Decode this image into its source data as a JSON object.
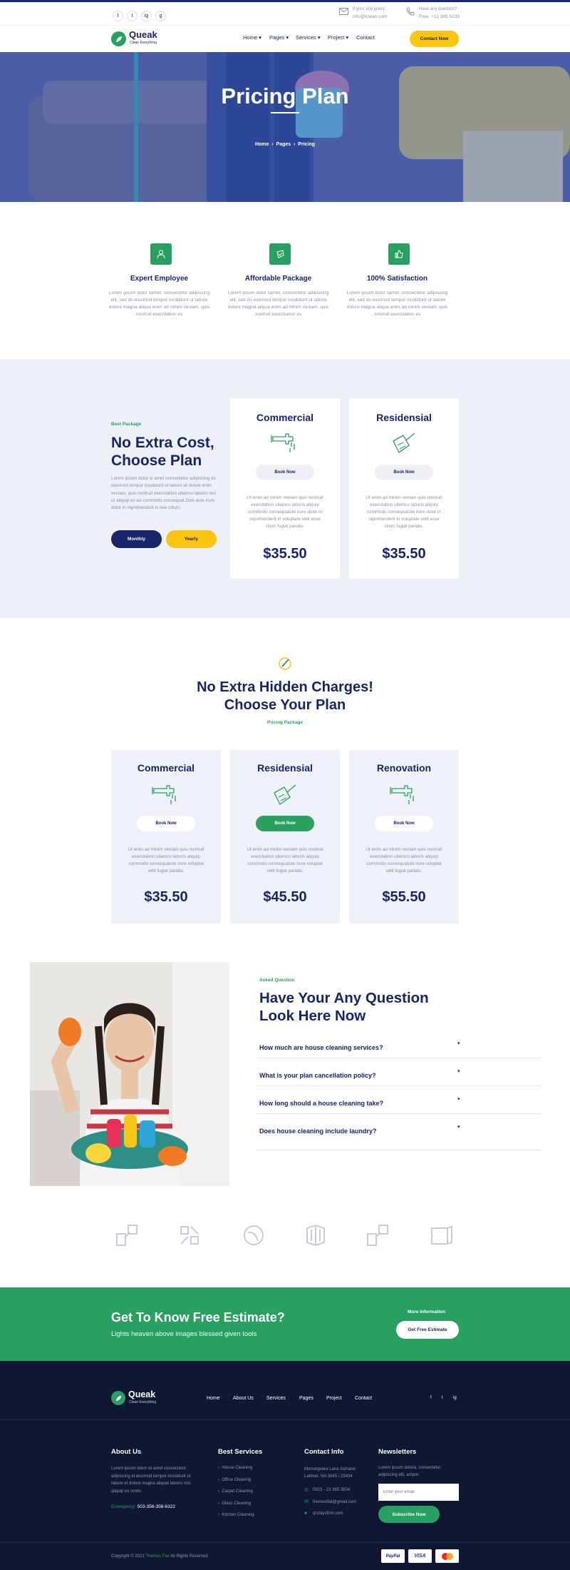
{
  "topbar": {
    "social": [
      "f",
      "t",
      "ig",
      "g"
    ],
    "query_label": "If your any query",
    "query_value": "info@tclean.com",
    "question_label": "Have any question?",
    "question_value": "Free. +12 365 5233"
  },
  "nav": {
    "brand": "Queak",
    "tagline": "Clean Everything",
    "items": [
      {
        "label": "Home"
      },
      {
        "label": "Pages"
      },
      {
        "label": "Services"
      },
      {
        "label": "Project"
      },
      {
        "label": "Contact"
      }
    ],
    "cta": "Contact Now"
  },
  "hero": {
    "title": "Pricing Plan",
    "crumbs": [
      "Home",
      "Pages",
      "Pricing"
    ]
  },
  "features": [
    {
      "icon": "employee-icon",
      "title": "Expert Employee",
      "desc": "Lorem ipsum dolor samet, consectetur adipiscing elit, sed do eiusmod tempor incididunt ut labore dolore magna aliqua enim ad minim veniam, quis nostrud exercitation es"
    },
    {
      "icon": "package-icon",
      "title": "Affordable Package",
      "desc": "Lorem ipsum dolor samet, consectetur adipiscing elit, sed do eiusmod tempor incididunt ut labore dolore magna aliqua enim ad minim veniam, quis nostrud exercitation es"
    },
    {
      "icon": "thumbs-up-icon",
      "title": "100% Satisfaction",
      "desc": "Lorem ipsum dolor samet, consectetur adipiscing elit, sed do eiusmod tempor incididunt ut labore dolore magna aliqua enim ad minim veniam, quis nostrud exercitation es"
    }
  ],
  "best": {
    "label": "Best Package",
    "title1": "No Extra Cost,",
    "title2": "Choose Plan",
    "desc": "Lorem ipsum dolor si amet consectetur adipiscing do eiusmod tempor incididunt ut labore et dolore enim veniam, quis nostrud exercitation ullamco laboris nisi ut aliquip ex ea commodo consequat Duis aute irure dolor in reprehenderit in see cillum.",
    "monthly": "Monthly",
    "yearly": "Yearly",
    "cards": [
      {
        "title": "Commercial",
        "icon": "faucet-icon",
        "button": "Book Now",
        "desc": "Ut enim ad minim veniam quis nostrud exercitation ullamco laboris aliquip commodo consequatute irure dolor in reprehenderit in voluptate velit esse cilum fugiat pariatu.",
        "price": "$35.50"
      },
      {
        "title": "Residensial",
        "icon": "dustpan-icon",
        "button": "Book Now",
        "desc": "Ut enim ad minim veniam quis nostrud exercitation ullamco laboris aliquip commodo consequatute irure dolor in reprehenderit in voluptate velit esse cilum fugiat pariatu.",
        "price": "$35.50"
      }
    ]
  },
  "hidden": {
    "title1": "No Extra Hidden Charges!",
    "title2": "Choose Your Plan",
    "label": "Pricing Package",
    "cards": [
      {
        "title": "Commercial",
        "icon": "faucet-icon",
        "button": "Book Now",
        "desc": "Ut enim ad minim veniam quis nostrud exercitation ullamco laboris aliquip commodo consequatute irure voluptat velit fugiat pariatu.",
        "price": "$35.50"
      },
      {
        "title": "Residensial",
        "icon": "dustpan-icon",
        "button": "Book Now",
        "desc": "Ut enim ad minim veniam quis nostrud exercitation ullamco laboris aliquip commodo consequatute irure voluptat velit fugiat pariatu.",
        "price": "$45.50"
      },
      {
        "title": "Renovation",
        "icon": "faucet-icon",
        "button": "Book Now",
        "desc": "Ut enim ad minim veniam quis nostrud exercitation ullamco laboris aliquip commodo consequatute irure voluptat velit fugiat pariatu.",
        "price": "$55.50"
      }
    ]
  },
  "faq": {
    "label": "Asked Question",
    "title1": "Have Your Any Question",
    "title2": "Look Here Now",
    "questions": [
      "How much are house cleaning services?",
      "What is your plan cancellation policy?",
      "How long should a house cleaning take?",
      "Does house cleaning include laundry?"
    ]
  },
  "estimate": {
    "title": "Get To Know Free Estimate?",
    "subtitle": "Lights heaven above images blessed given tools",
    "more": "More Information",
    "button": "Get Free Estimate"
  },
  "footer": {
    "brand": "Queak",
    "tagline": "Clean Everything",
    "menu": [
      "Home",
      "About Us",
      "Services",
      "Pages",
      "Project",
      "Contact"
    ],
    "social": [
      "f",
      "t",
      "ig"
    ],
    "about_title": "About Us",
    "about_text": "Lorem ipsum dolor sit amet consectetur adipiscing el eiusmod tempor incididunt ut labore et dolore magna aliquat laboris nisi aliquip ex cmdo.",
    "emergency_label": "Emergency:",
    "emergency_value": "503-356-356-6322",
    "services_title": "Best Services",
    "services": [
      "House Cleaning",
      "Office Cleaning",
      "Carpet Cleaning",
      "Glass Cleaning",
      "Kitchen Cleaning"
    ],
    "contact_title": "Contact Info",
    "address": "Morningview Lane Ashland Latimer, NA 3045 / 23434",
    "phone": "0923 - 23 365 3654",
    "email": "themesflat@gmail.com",
    "web": "qrstaysfirm.com",
    "news_title": "Newsletters",
    "news_text": "Lorem ipsum dolora, consectetur adipiscing elit, ampor.",
    "email_placeholder": "Enter your email",
    "subscribe": "Subscribe Now",
    "copyright_pre": "Copyright © 2021",
    "copyright_brand": "Themes Flat",
    "copyright_post": "All Rights Reserved",
    "payments": [
      "PayPal",
      "VISA",
      "MasterCard"
    ]
  },
  "colors": {
    "navy": "#17256b",
    "green": "#27a060",
    "yellow": "#fdc50f",
    "footer": "#0f1733"
  }
}
